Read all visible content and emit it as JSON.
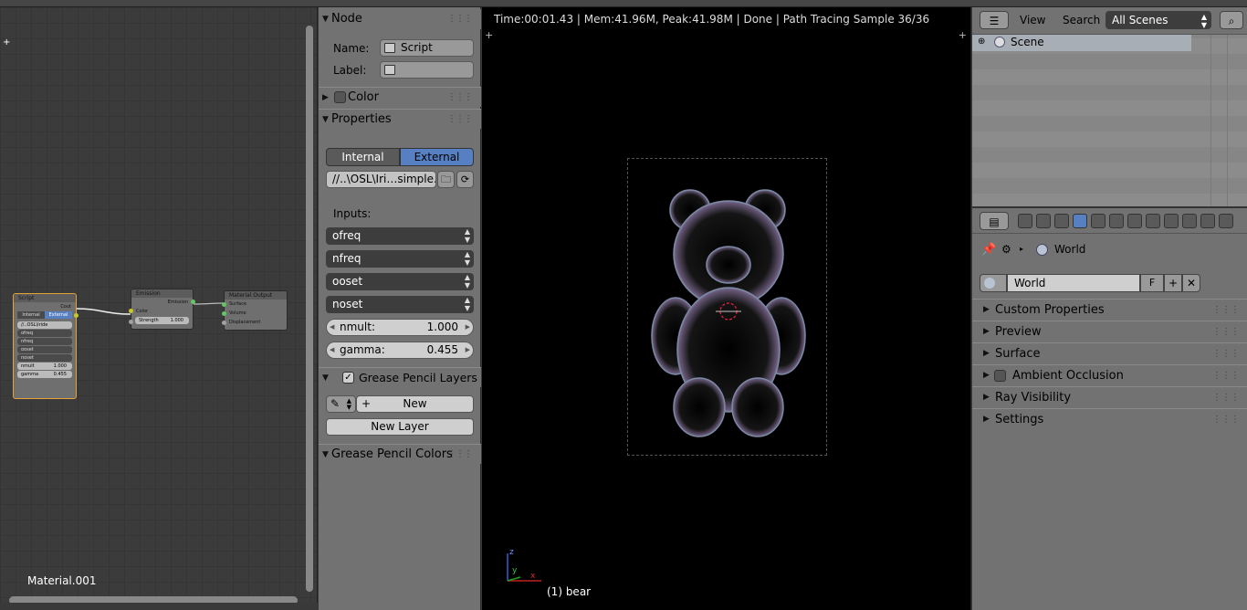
{
  "node_editor": {
    "material_name": "Material.001",
    "nodes": {
      "script": {
        "title": "Script",
        "output": "Cout",
        "tabs": [
          "Internal",
          "External"
        ],
        "file": "//..OSL\\Iride",
        "inputs": [
          "ofreq",
          "nfreq",
          "ooset",
          "noset"
        ],
        "nmult_label": "nmult",
        "nmult_value": "1.000",
        "gamma_label": "gamma",
        "gamma_value": "0.455"
      },
      "emission": {
        "title": "Emission",
        "output": "Emission",
        "input_color": "Color",
        "strength_label": "Strength",
        "strength_value": "1.000"
      },
      "material_output": {
        "title": "Material Output",
        "inputs": [
          "Surface",
          "Volume",
          "Displacement"
        ]
      }
    }
  },
  "node_panel": {
    "node_header": "Node",
    "name_label": "Name:",
    "name_value": "Script",
    "label_label": "Label:",
    "label_value": "",
    "color_header": "Color",
    "properties_header": "Properties",
    "mode_tabs": [
      "Internal",
      "External"
    ],
    "active_mode": "External",
    "file_path": "//..\\OSL\\Iri…simple.osl",
    "inputs_label": "Inputs:",
    "input_dropdowns": [
      "ofreq",
      "nfreq",
      "ooset",
      "noset"
    ],
    "nmult_label": "nmult:",
    "nmult_value": "1.000",
    "gamma_label": "gamma:",
    "gamma_value": "0.455",
    "grease_layers_header": "Grease Pencil Layers",
    "new_button": "New",
    "new_layer_button": "New Layer",
    "grease_colors_header": "Grease Pencil Colors"
  },
  "viewport": {
    "render_info": "Time:00:01.43 | Mem:41.96M, Peak:41.98M | Done | Path Tracing Sample 36/36",
    "object_label": "(1) bear",
    "axis_labels": {
      "x": "x",
      "y": "y",
      "z": "z"
    }
  },
  "outliner": {
    "view_label": "View",
    "search_label": "Search",
    "scene_filter": "All Scenes",
    "scene_item": "Scene"
  },
  "properties": {
    "breadcrumb": "World",
    "world_name": "World",
    "fake_user": "F",
    "sections": [
      "Custom Properties",
      "Preview",
      "Surface",
      "Ambient Occlusion",
      "Ray Visibility",
      "Settings"
    ]
  },
  "colors": {
    "accent_blue": "#5680c2",
    "socket_yellow": "#c7c729",
    "socket_green": "#63c763",
    "socket_grey": "#a1a1a1",
    "node_select": "#e8a136"
  }
}
